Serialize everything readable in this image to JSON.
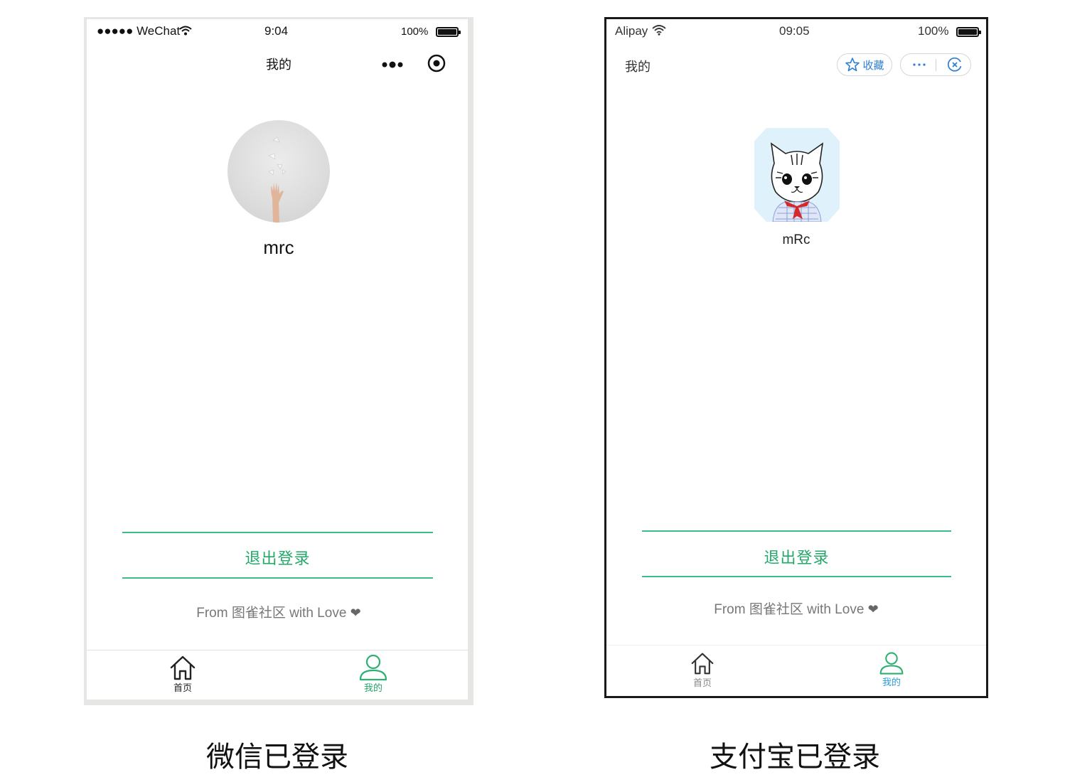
{
  "wechat": {
    "status": {
      "carrier": "●●●●● WeChat",
      "time": "9:04",
      "battery": "100%"
    },
    "nav_title": "我的",
    "username": "mrc",
    "logout_label": "退出登录",
    "footer_text": "From 图雀社区 with Love",
    "tabs": [
      {
        "label": "首页",
        "icon": "home-icon"
      },
      {
        "label": "我的",
        "icon": "user-icon"
      }
    ],
    "colors": {
      "accent": "#23a86a",
      "line": "#3cbd8a"
    }
  },
  "alipay": {
    "status": {
      "carrier": "Alipay",
      "time": "09:05",
      "battery": "100%"
    },
    "nav_title": "我的",
    "favorite_label": "收藏",
    "username": "mRc",
    "logout_label": "退出登录",
    "footer_text": "From 图雀社区 with Love",
    "tabs": [
      {
        "label": "首页",
        "icon": "home-icon"
      },
      {
        "label": "我的",
        "icon": "user-icon"
      }
    ],
    "colors": {
      "accent": "#23a86a",
      "tab_active": "#2d9de0",
      "line": "#3cbd8a"
    }
  },
  "captions": {
    "wechat": "微信已登录",
    "alipay": "支付宝已登录"
  }
}
